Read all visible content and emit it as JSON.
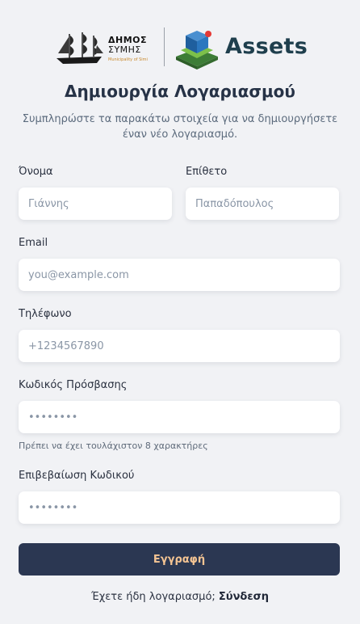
{
  "brand": {
    "simi_line1": "ΔΗΜΟΣ",
    "simi_line2": "ΣΥΜΗΣ",
    "simi_line3": "Municipality of Simi",
    "assets_name": "Assets",
    "colors": {
      "navy": "#2b3752",
      "accent": "#f4c493",
      "cube_blue": "#2b6fb0",
      "cube_green": "#4caf50",
      "dot_red": "#e53935"
    }
  },
  "header": {
    "title": "Δημιουργία Λογαριασμού",
    "subtitle": "Συμπληρώστε τα παρακάτω στοιχεία για να δημιουργήσετε έναν νέο λογαριασμό."
  },
  "form": {
    "first_name": {
      "label": "Όνομα",
      "placeholder": "Γιάννης"
    },
    "last_name": {
      "label": "Επίθετο",
      "placeholder": "Παπαδόπουλος"
    },
    "email": {
      "label": "Email",
      "placeholder": "you@example.com"
    },
    "phone": {
      "label": "Τηλέφωνο",
      "placeholder": "+1234567890"
    },
    "password": {
      "label": "Κωδικός Πρόσβασης",
      "placeholder": "••••••••",
      "hint": "Πρέπει να έχει τουλάχιστον 8 χαρακτήρες"
    },
    "confirm_password": {
      "label": "Επιβεβαίωση Κωδικού",
      "placeholder": "••••••••"
    },
    "submit_label": "Εγγραφή"
  },
  "footer": {
    "prompt": "Έχετε ήδη λογαριασμό;",
    "link_label": "Σύνδεση"
  }
}
